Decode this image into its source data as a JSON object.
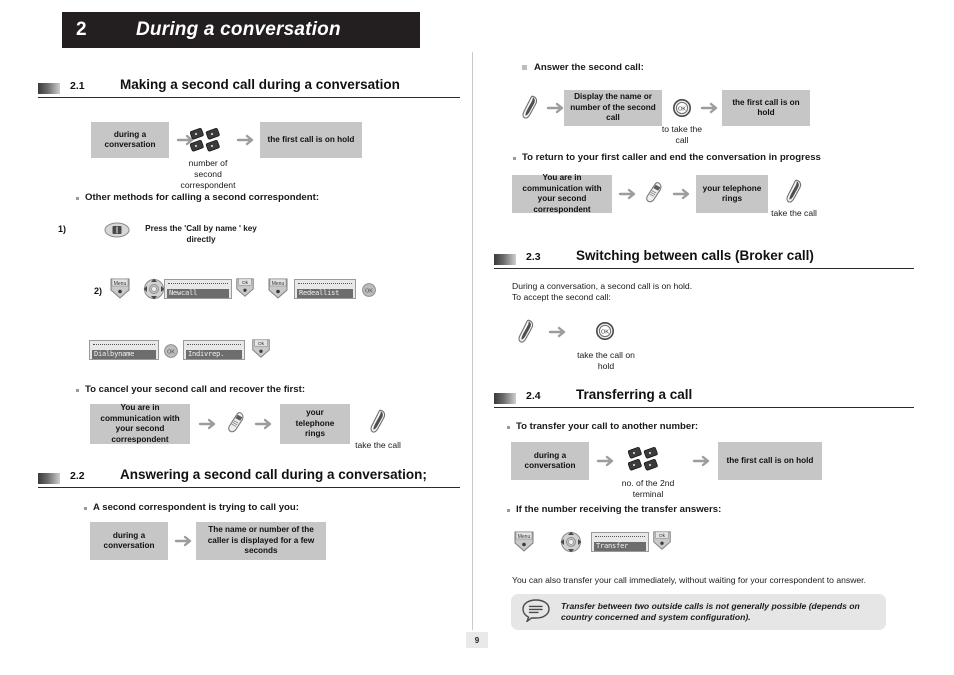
{
  "chapter": {
    "number": "2",
    "title": "During a conversation"
  },
  "page_number": "9",
  "sections": {
    "s21": {
      "num": "2.1",
      "title": "Making a second call during a conversation"
    },
    "s22": {
      "num": "2.2",
      "title": "Answering a second call during a conversation;"
    },
    "s23": {
      "num": "2.3",
      "title": "Switching between calls (Broker call)"
    },
    "s24": {
      "num": "2.4",
      "title": "Transferring a call"
    }
  },
  "left": {
    "flow1": {
      "box1": "during a\nconversation",
      "keypad_caption": "number of\nsecond\ncorrespondent",
      "box2": "the first call is on hold"
    },
    "other_methods_bullet": "Other methods for calling a second correspondent:",
    "method1": {
      "index": "1)",
      "label": "Press the 'Call by name ' key\ndirectly"
    },
    "method2": {
      "index": "2)",
      "menu_key": "Menu",
      "ok_key": "Ok",
      "screen1": "Newcall",
      "screen2": "Redeallist"
    },
    "method3": {
      "screen1": "Dialbyname",
      "screen2": "Indivrep.",
      "ok_key": "Ok"
    },
    "cancel_bullet": "To cancel your second call and recover the first:",
    "flow2": {
      "box1": "You are in communication\nwith your second\ncorrespondent",
      "box2": "your telephone\nrings",
      "caption": "take the call"
    },
    "s22_bullet": "A second correspondent is trying to call you:",
    "flow3": {
      "box1": "during a\nconversation",
      "box2": "The name or number of the caller is\ndisplayed for a few seconds"
    }
  },
  "right": {
    "answer_bullet": "Answer the second call:",
    "flow1": {
      "box1": "Display the name or number\nof the second call",
      "ok_caption": "to take the\ncall",
      "box2": "the first call is on hold"
    },
    "return_bullet": "To return to your first caller and end the conversation in progress",
    "flow2": {
      "box1": "You are in communication\nwith your second\ncorrespondent",
      "box2": "your telephone\nrings",
      "caption": "take the call"
    },
    "s23_text": "During a conversation, a second call is on hold.\nTo accept the second call:",
    "flow3": {
      "caption": "take the call on\nhold"
    },
    "transfer_bullet": "To transfer your call to another number:",
    "flow4": {
      "box1": "during a\nconversation",
      "keypad_caption": "no. of the 2nd\nterminal",
      "box2": "the first call is on hold"
    },
    "answers_bullet": "If the number receiving the transfer answers:",
    "flow5": {
      "menu_key": "Menu",
      "screen": "Transfer",
      "ok_key": "Ok"
    },
    "immediate_text": "You can also transfer your call immediately, without waiting for your correspondent to answer.",
    "note": "Transfer between two outside calls is not generally possible (depends on country concerned and system configuration)."
  }
}
